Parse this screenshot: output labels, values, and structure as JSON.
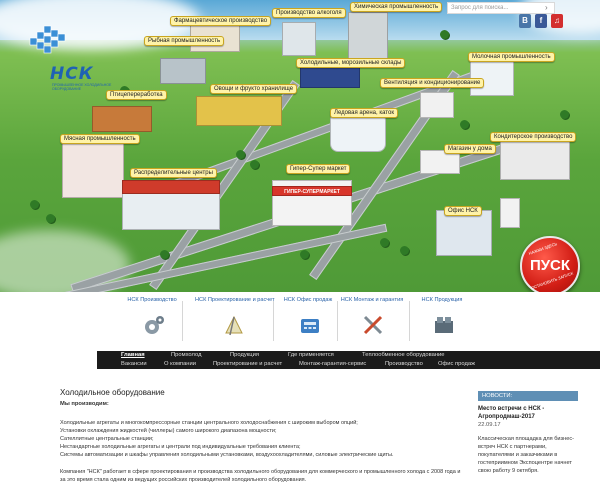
{
  "hero": {
    "brand": "НСК",
    "brand_sub": "ПРОМЫШЛЕННОЕ ХОЛОДИЛЬНОЕ ОБОРУДОВАНИЕ",
    "search_placeholder": "Запрос для поиска...",
    "social": [
      "В",
      "f",
      "♫"
    ],
    "map_labels": [
      {
        "key": "pharma",
        "text": "Фармацевтическое производство"
      },
      {
        "key": "alcohol",
        "text": "Производство алкоголя"
      },
      {
        "key": "chem",
        "text": "Химическая промышленность"
      },
      {
        "key": "fish",
        "text": "Рыбная промышленность"
      },
      {
        "key": "cold",
        "text": "Холодильные, морозильные склады"
      },
      {
        "key": "milk",
        "text": "Молочная промышленность"
      },
      {
        "key": "vent",
        "text": "Вентиляция и кондиционирование"
      },
      {
        "key": "poultry",
        "text": "Птицепереработка"
      },
      {
        "key": "veg",
        "text": "Овощи и фрукто хранилище"
      },
      {
        "key": "ice",
        "text": "Ледовая арена, каток"
      },
      {
        "key": "meat",
        "text": "Мясная промышленность"
      },
      {
        "key": "confect",
        "text": "Кондитерское производство"
      },
      {
        "key": "shop",
        "text": "Магазин у дома"
      },
      {
        "key": "dist",
        "text": "Распределительные центры"
      },
      {
        "key": "hyper",
        "text": "Гипер-Супер маркет"
      },
      {
        "key": "office",
        "text": "Офис НСК"
      }
    ],
    "hyper_sign": "ГИПЕР-СУПЕРМАРКЕТ",
    "pusk": "ПУСК",
    "pusk_ring_top": "НАЖМИ ЗДЕСЬ",
    "pusk_ring_bottom": "ОСТАНОВИТЬ ЗАПУСК"
  },
  "categories": [
    {
      "label": "НСК Производство",
      "icon": "gears-icon"
    },
    {
      "label": "НСК Проектирование и расчет",
      "icon": "compass-icon"
    },
    {
      "label": "НСК Офис продаж",
      "icon": "phone-icon"
    },
    {
      "label": "НСК Монтаж и гарантия",
      "icon": "tools-icon"
    },
    {
      "label": "НСК Продукция",
      "icon": "compressor-icon"
    }
  ],
  "nav": {
    "row1": [
      "Главная",
      "Промхолод",
      "Продукция",
      "Где применяется",
      "Теплообменное оборудование"
    ],
    "row2": [
      "Вакансии",
      "О компании",
      "Проектирование и расчет",
      "Монтаж-гарантия-сервис",
      "Производство",
      "Офис продаж"
    ]
  },
  "content": {
    "title": "Холодильное оборудование",
    "subtitle": "Мы производим:",
    "items": [
      "Холодильные агрегаты и многокомпрессорные станции центрального холодоснабжения с широким выбором опций;",
      "Установки охлаждения жидкостей (чиллеры) самого широкого диапазона мощности;",
      "Сателлитные центральные станции;",
      "Нестандартные холодильные агрегаты и централи под индивидуальные требования клиента;",
      "Системы автоматизации и шкафы управления холодильными установками, воздухоохладителями, силовые электрические щиты."
    ],
    "para": "Компания \"НСК\" работает в сфере проектирования и производства холодильного оборудования для коммерческого и промышленного холода с 2008 года и за это время стала одним из ведущих российских производителей холодильного оборудования."
  },
  "news": {
    "header": "НОВОСТИ:",
    "title": "Место встречи с НСК - Агропродмаш-2017",
    "date": "22.09.17",
    "text": "Классическая площадка для бизнес-встреч НСК с партнерами, покупателями и заказчиками в гостеприимном Экспоцентре начнет свою работу 9 октября."
  },
  "colors": {
    "nav_bg": "#1b1b1b",
    "brand_blue": "#1f62b4",
    "news_header": "#5f8fb5",
    "tag_bg": "#fff3a8",
    "pusk_red": "#d11d15"
  }
}
